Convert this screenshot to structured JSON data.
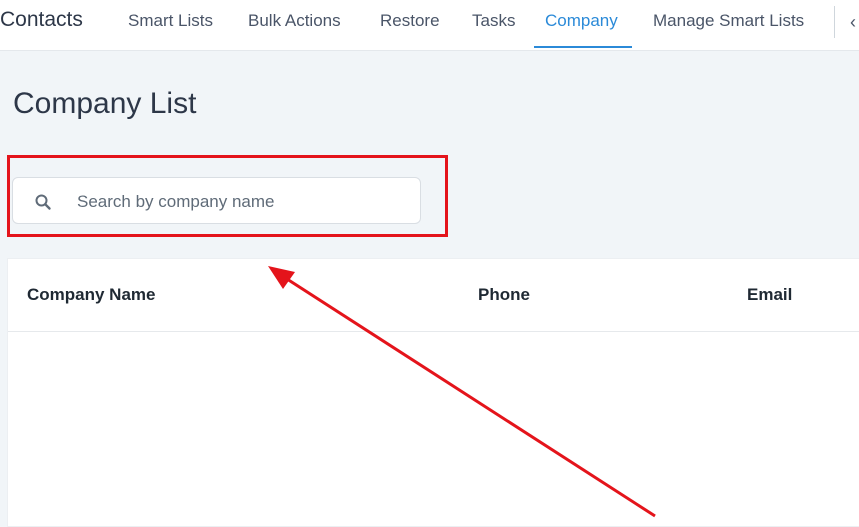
{
  "nav": {
    "brand": "Contacts",
    "items": [
      {
        "label": "Smart Lists",
        "active": false
      },
      {
        "label": "Bulk Actions",
        "active": false
      },
      {
        "label": "Restore",
        "active": false
      },
      {
        "label": "Tasks",
        "active": false
      },
      {
        "label": "Company",
        "active": true
      },
      {
        "label": "Manage Smart Lists",
        "active": false
      }
    ]
  },
  "page": {
    "title": "Company List"
  },
  "search": {
    "placeholder": "Search by company name",
    "value": ""
  },
  "table": {
    "columns": [
      "Company Name",
      "Phone",
      "Email"
    ]
  },
  "annotation": {
    "color": "#e4141b"
  },
  "colors": {
    "accent": "#2b8ad8",
    "background": "#f1f5f8"
  }
}
